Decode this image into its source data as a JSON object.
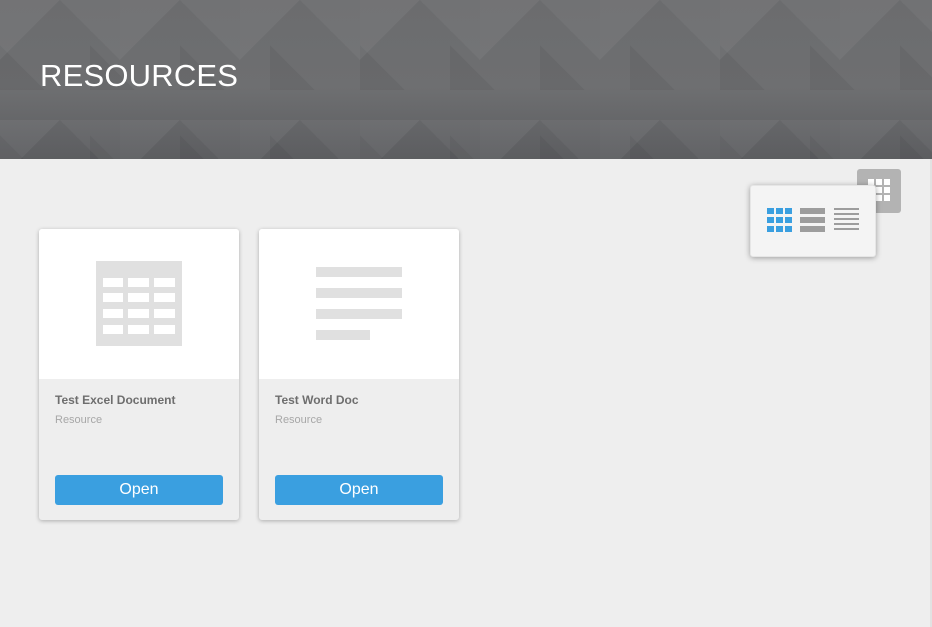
{
  "header": {
    "title": "RESOURCES"
  },
  "view_toggle": {
    "icon": "grid-icon",
    "options": [
      {
        "icon": "grid-view-icon",
        "selected": true
      },
      {
        "icon": "tile-list-view-icon",
        "selected": false
      },
      {
        "icon": "list-view-icon",
        "selected": false
      }
    ]
  },
  "resources": [
    {
      "title": "Test Excel Document",
      "type": "Resource",
      "icon": "spreadsheet-icon",
      "button_label": "Open"
    },
    {
      "title": "Test Word Doc",
      "type": "Resource",
      "icon": "document-icon",
      "button_label": "Open"
    }
  ],
  "colors": {
    "accent": "#3a9fe0",
    "header_bg": "#6b6c6e",
    "page_bg": "#eeeeee",
    "placeholder_icon": "#e0e0e0"
  }
}
